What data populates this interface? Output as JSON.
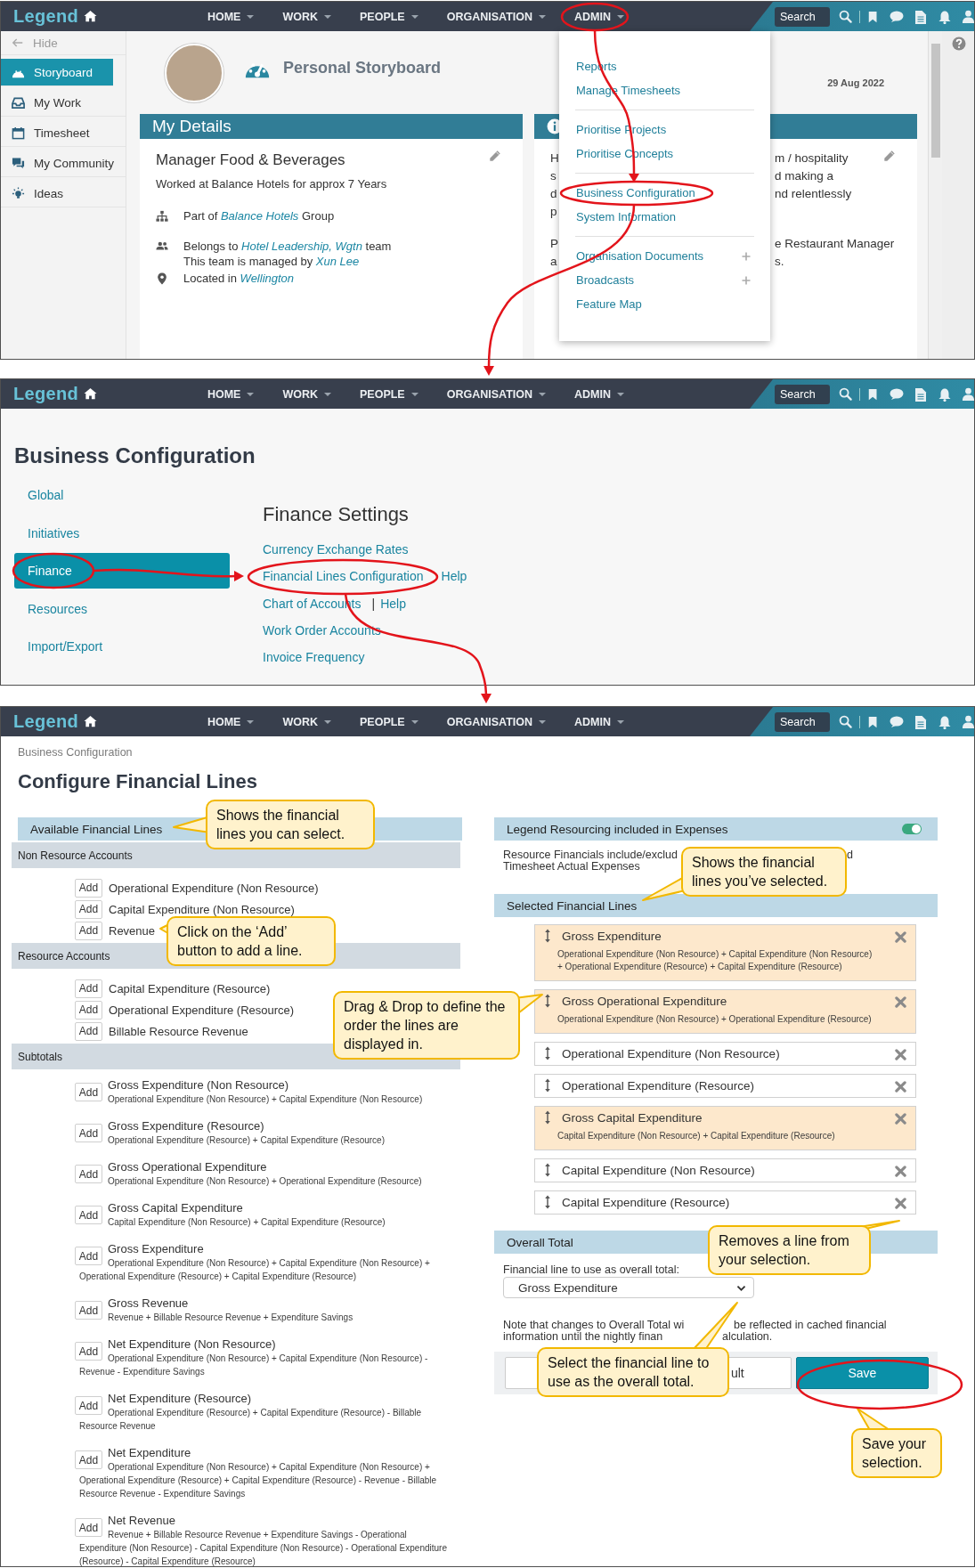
{
  "storyboard_screen": {
    "navbar": {
      "logo": "Legend",
      "menu": [
        "HOME",
        "WORK",
        "PEOPLE",
        "ORGANISATION",
        "ADMIN"
      ],
      "search": {
        "placeholder": "Search"
      }
    },
    "sidebar": {
      "hide_label": "Hide",
      "items": [
        {
          "kind": "storyboard",
          "label": "Storyboard",
          "selected": true
        },
        {
          "kind": "work",
          "label": "My Work",
          "selected": false
        },
        {
          "kind": "timesheet",
          "label": "Timesheet",
          "selected": false
        },
        {
          "kind": "community",
          "label": "My Community",
          "selected": false
        },
        {
          "kind": "ideas",
          "label": "Ideas",
          "selected": false
        }
      ]
    },
    "page_title": "Personal Storyboard",
    "date": "29 Aug 2022",
    "details_card": {
      "title": "My Details",
      "role": "Manager Food & Beverages",
      "tenure": "Worked at Balance Hotels for approx 7 Years",
      "facts": [
        {
          "kind": "org",
          "text": "Part of *Balance Hotels* Group"
        },
        {
          "kind": "team",
          "text": "Belongs to *Hotel Leadership, Wgtn* team"
        },
        {
          "kind": "plain",
          "text": "This team is managed by *Xun Lee*"
        },
        {
          "kind": "location",
          "text": "Located in *Wellington*"
        }
      ]
    },
    "info_card": {
      "paragraphs": [
        [
          {
            "left": "H",
            "right": "m / hospitality"
          },
          {
            "left": "s",
            "right": "d making a"
          },
          {
            "left": "d",
            "right": "nd relentlessly"
          },
          {
            "left": "p"
          }
        ],
        [
          {
            "left": "P",
            "right": "e Restaurant Manager"
          },
          {
            "left": "a",
            "right": "s."
          }
        ]
      ]
    },
    "admin_menu": {
      "groups": [
        [
          {
            "label": "Reports",
            "expandable": false
          },
          {
            "label": "Manage Timesheets",
            "expandable": false
          }
        ],
        [
          {
            "label": "Prioritise Projects",
            "expandable": false
          },
          {
            "label": "Prioritise Concepts",
            "expandable": false
          }
        ],
        [
          {
            "label": "Business Configuration",
            "expandable": false
          },
          {
            "label": "System Information",
            "expandable": false
          }
        ],
        [
          {
            "label": "Organisation Documents",
            "expandable": true
          },
          {
            "label": "Broadcasts",
            "expandable": true
          },
          {
            "label": "Feature Map",
            "expandable": false
          }
        ]
      ]
    }
  },
  "business_configuration_screen": {
    "navbar": {
      "logo": "Legend",
      "menu": [
        "HOME",
        "WORK",
        "PEOPLE",
        "ORGANISATION",
        "ADMIN"
      ],
      "search": {
        "placeholder": "Search"
      }
    },
    "title": "Business Configuration",
    "nav": [
      {
        "label": "Global",
        "selected": false
      },
      {
        "label": "Initiatives",
        "selected": false
      },
      {
        "label": "Finance",
        "selected": true
      },
      {
        "label": "Resources",
        "selected": false
      },
      {
        "label": "Import/Export",
        "selected": false
      }
    ],
    "section_title": "Finance Settings",
    "links": [
      {
        "label": "Currency Exchange Rates"
      },
      {
        "label": "Financial Lines Configuration",
        "help": "Help"
      },
      {
        "label": "Chart of Accounts",
        "separator": "|",
        "help": "Help"
      },
      {
        "label": "Work Order Accounts"
      },
      {
        "label": "Invoice Frequency"
      }
    ]
  },
  "financial_lines_screen": {
    "navbar": {
      "logo": "Legend",
      "menu": [
        "HOME",
        "WORK",
        "PEOPLE",
        "ORGANISATION",
        "ADMIN"
      ],
      "search": {
        "placeholder": "Search"
      }
    },
    "breadcrumb": "Business Configuration",
    "title": "Configure Financial Lines",
    "available": {
      "title": "Available Financial Lines",
      "groups": [
        {
          "title": "Non Resource Accounts",
          "items": [
            {
              "name": "Operational Expenditure (Non Resource)",
              "button": "Add"
            },
            {
              "name": "Capital Expenditure (Non Resource)",
              "button": "Add"
            },
            {
              "name": "Revenue",
              "button": "Add"
            }
          ]
        },
        {
          "title": "Resource Accounts",
          "items": [
            {
              "name": "Capital Expenditure (Resource)",
              "button": "Add"
            },
            {
              "name": "Operational Expenditure (Resource)",
              "button": "Add"
            },
            {
              "name": "Billable Resource Revenue",
              "button": "Add"
            }
          ]
        },
        {
          "title": "Subtotals",
          "items": [
            {
              "name": "Gross Expenditure (Non Resource)",
              "formula": "Operational Expenditure (Non Resource) + Capital Expenditure (Non Resource)",
              "button": "Add"
            },
            {
              "name": "Gross Expenditure (Resource)",
              "formula": "Operational Expenditure (Resource) + Capital Expenditure (Resource)",
              "button": "Add"
            },
            {
              "name": "Gross Operational Expenditure",
              "formula": "Operational Expenditure (Non Resource) + Operational Expenditure (Resource)",
              "button": "Add"
            },
            {
              "name": "Gross Capital Expenditure",
              "formula": "Capital Expenditure (Non Resource) + Capital Expenditure (Resource)",
              "button": "Add"
            },
            {
              "name": "Gross Expenditure",
              "formula": "Operational Expenditure (Non Resource) + Capital Expenditure (Non Resource) + Operational Expenditure (Resource) + Capital Expenditure (Resource)",
              "button": "Add"
            },
            {
              "name": "Gross Revenue",
              "formula": "Revenue + Billable Resource Revenue + Expenditure Savings",
              "button": "Add"
            },
            {
              "name": "Net Expenditure (Non Resource)",
              "formula": "Operational Expenditure (Non Resource) + Capital Expenditure (Non Resource) - Revenue - Expenditure Savings",
              "button": "Add"
            },
            {
              "name": "Net Expenditure (Resource)",
              "formula": "Operational Expenditure (Resource) + Capital Expenditure (Resource) - Billable Resource Revenue",
              "button": "Add"
            },
            {
              "name": "Net Expenditure",
              "formula": "Operational Expenditure (Non Resource) + Capital Expenditure (Non Resource) + Operational Expenditure (Resource) + Capital Expenditure (Resource) - Revenue - Billable Resource Revenue - Expenditure Savings",
              "button": "Add"
            },
            {
              "name": "Net Revenue",
              "formula": "Revenue + Billable Resource Revenue + Expenditure Savings - Operational Expenditure (Non Resource) - Capital Expenditure (Non Resource) - Operational Expenditure (Resource) - Capital Expenditure (Resource)",
              "button": "Add"
            }
          ]
        }
      ]
    },
    "resourcing": {
      "title": "Legend Resourcing included in Expenses",
      "on": true,
      "description": [
        [
          "Resource Financials include/exclud",
          "d"
        ],
        [
          "Timesheet Actual Expenses"
        ]
      ]
    },
    "selected": {
      "title": "Selected Financial Lines",
      "items": [
        {
          "kind": "subtotal",
          "name": "Gross Expenditure",
          "formula": "Operational Expenditure (Non Resource) + Capital Expenditure (Non Resource) + Operational Expenditure (Resource) + Capital Expenditure (Resource)"
        },
        {
          "kind": "subtotal",
          "name": "Gross Operational Expenditure",
          "formula": "Operational Expenditure (Non Resource) + Operational Expenditure (Resource)"
        },
        {
          "kind": "account",
          "name": "Operational Expenditure (Non Resource)"
        },
        {
          "kind": "account",
          "name": "Operational Expenditure (Resource)"
        },
        {
          "kind": "subtotal",
          "name": "Gross Capital Expenditure",
          "formula": "Capital Expenditure (Non Resource) + Capital Expenditure (Resource)"
        },
        {
          "kind": "account",
          "name": "Capital Expenditure (Non Resource)"
        },
        {
          "kind": "account",
          "name": "Capital Expenditure (Resource)"
        }
      ]
    },
    "overall_total": {
      "title": "Overall Total",
      "label": "Financial line to use as overall total:",
      "value": "Gross Expenditure",
      "note": [
        [
          "Note that changes to Overall Total wi",
          "be reflected in cached financial"
        ],
        [
          "information until the nightly finan",
          "alculation."
        ]
      ]
    },
    "buttons": [
      {
        "kind": "secondary",
        "label": "ult"
      },
      {
        "kind": "primary",
        "label": "Save"
      }
    ]
  },
  "callouts": [
    {
      "text": "Shows the financial lines you can select."
    },
    {
      "text": "Click on the ‘Add’ button to add a line."
    },
    {
      "text": "Drag & Drop to define the order the lines are displayed in."
    },
    {
      "text": "Shows the financial lines you’ve selected."
    },
    {
      "text": "Removes a line from your selection."
    },
    {
      "text": "Select the financial line to use as the overall total."
    },
    {
      "text": "Save your selection."
    }
  ]
}
